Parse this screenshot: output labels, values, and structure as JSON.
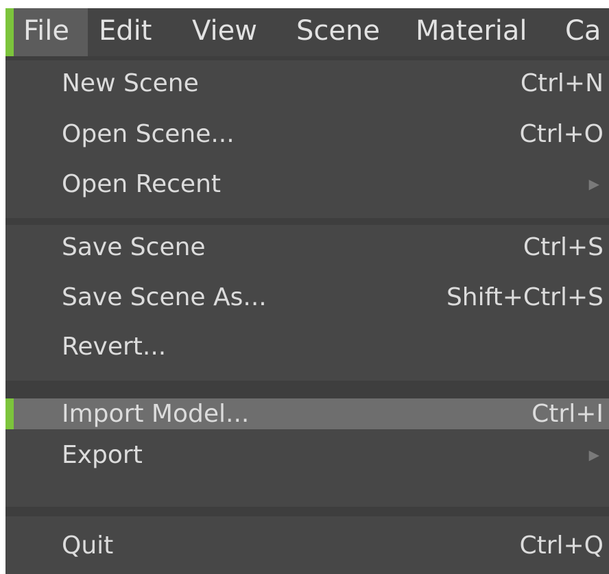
{
  "menubar": {
    "items": [
      "File",
      "Edit",
      "View",
      "Scene",
      "Material",
      "Ca"
    ],
    "active_index": 0
  },
  "file_menu": {
    "groups": [
      [
        {
          "label": "New Scene",
          "shortcut": "Ctrl+N"
        },
        {
          "label": "Open Scene...",
          "shortcut": "Ctrl+O"
        },
        {
          "label": "Open Recent",
          "submenu": true
        }
      ],
      [
        {
          "label": "Save Scene",
          "shortcut": "Ctrl+S"
        },
        {
          "label": "Save Scene As...",
          "shortcut": "Shift+Ctrl+S"
        },
        {
          "label": "Revert..."
        }
      ],
      [
        {
          "label": "Import Model...",
          "shortcut": "Ctrl+I",
          "highlighted": true
        },
        {
          "label": "Export",
          "submenu": true
        }
      ],
      [
        {
          "label": "Quit",
          "shortcut": "Ctrl+Q"
        }
      ]
    ],
    "submenu_arrow": "▶"
  },
  "colors": {
    "accent": "#7cc43c",
    "menubar_bg": "#444444",
    "menu_bg": "#474747",
    "separator": "#3e3e3e",
    "highlight_bg": "#6e6e6e",
    "text": "#dcdcdc"
  }
}
